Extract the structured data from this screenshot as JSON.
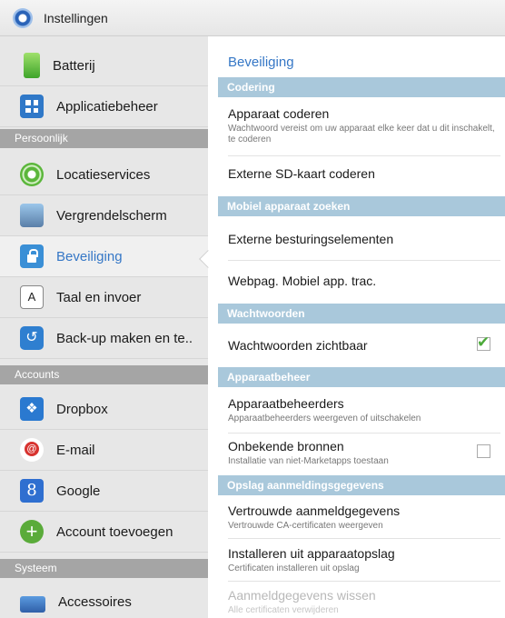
{
  "topbar": {
    "title": "Instellingen"
  },
  "sidebar": {
    "items": [
      {
        "label": "Batterij"
      },
      {
        "label": "Applicatiebeheer"
      },
      {
        "label": "Locatieservices"
      },
      {
        "label": "Vergrendelscherm"
      },
      {
        "label": "Beveiliging"
      },
      {
        "label": "Taal en invoer"
      },
      {
        "label": "Back-up maken en te.."
      },
      {
        "label": "Dropbox"
      },
      {
        "label": "E-mail"
      },
      {
        "label": "Google"
      },
      {
        "label": "Account toevoegen"
      },
      {
        "label": "Accessoires"
      }
    ],
    "categories": {
      "personal": "Persoonlijk",
      "accounts": "Accounts",
      "system": "Systeem"
    },
    "icon_glyphs": {
      "language": "A",
      "google": "8",
      "add": "+"
    }
  },
  "panel": {
    "title": "Beveiliging",
    "sections": {
      "encryption": "Codering",
      "find_device": "Mobiel apparaat zoeken",
      "passwords": "Wachtwoorden",
      "device_admin": "Apparaatbeheer",
      "credential_storage": "Opslag aanmeldingsgegevens"
    },
    "rows": {
      "encrypt_device": {
        "title": "Apparaat coderen",
        "summary": "Wachtwoord vereist om uw apparaat elke keer dat u dit inschakelt, te coderen"
      },
      "encrypt_sd": {
        "title": "Externe SD-kaart coderen"
      },
      "remote_controls": {
        "title": "Externe besturingselementen"
      },
      "web_tracker": {
        "title": "Webpag. Mobiel app. trac."
      },
      "show_passwords": {
        "title": "Wachtwoorden zichtbaar",
        "checked": true
      },
      "device_admins": {
        "title": "Apparaatbeheerders",
        "summary": "Apparaatbeheerders weergeven of uitschakelen"
      },
      "unknown_sources": {
        "title": "Onbekende bronnen",
        "summary": "Installatie van niet-Marketapps toestaan",
        "checked": false
      },
      "trusted_credentials": {
        "title": "Vertrouwde aanmeldgegevens",
        "summary": "Vertrouwde CA-certificaten weergeven"
      },
      "install_storage": {
        "title": "Installeren uit apparaatopslag",
        "summary": "Certificaten installeren uit opslag"
      },
      "clear_credentials": {
        "title": "Aanmeldgegevens wissen",
        "summary": "Alle certificaten verwijderen",
        "disabled": true
      }
    }
  },
  "colors": {
    "accent": "#3577c6",
    "section_header": "#a9c8db",
    "category_header": "#a5a5a5",
    "check": "#4caa3a"
  }
}
